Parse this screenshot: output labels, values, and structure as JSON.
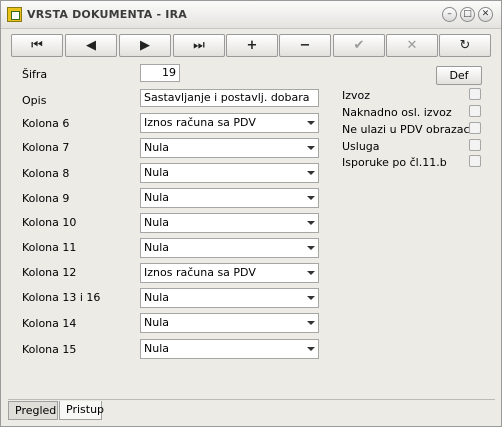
{
  "window": {
    "title": "VRSTA DOKUMENTA - IRA"
  },
  "toolbar": {
    "buttons": [
      {
        "icon": "first-record-icon",
        "glyph": "⏮"
      },
      {
        "icon": "prev-record-icon",
        "glyph": "◀"
      },
      {
        "icon": "next-record-icon",
        "glyph": "▶"
      },
      {
        "icon": "last-record-icon",
        "glyph": "⏭"
      },
      {
        "icon": "add-icon",
        "glyph": "+"
      },
      {
        "icon": "delete-icon",
        "glyph": "−"
      },
      {
        "icon": "confirm-icon",
        "glyph": "✔"
      },
      {
        "icon": "cancel-icon",
        "glyph": "✕"
      },
      {
        "icon": "refresh-icon",
        "glyph": "↻"
      }
    ]
  },
  "form": {
    "sifra_label": "Šifra",
    "sifra_value": "19",
    "opis_label": "Opis",
    "opis_value": "Sastavljanje i postavlj. dobara",
    "def_button": "Def",
    "columns": [
      {
        "label": "Kolona 6",
        "value": "Iznos računa sa PDV"
      },
      {
        "label": "Kolona 7",
        "value": "Nula"
      },
      {
        "label": "Kolona 8",
        "value": "Nula"
      },
      {
        "label": "Kolona 9",
        "value": "Nula"
      },
      {
        "label": "Kolona 10",
        "value": "Nula"
      },
      {
        "label": "Kolona 11",
        "value": "Nula"
      },
      {
        "label": "Kolona 12",
        "value": "Iznos računa sa PDV"
      },
      {
        "label": "Kolona 13 i 16",
        "value": "Nula"
      },
      {
        "label": "Kolona 14",
        "value": "Nula"
      },
      {
        "label": "Kolona 15",
        "value": "Nula"
      }
    ],
    "checkboxes": [
      {
        "label": "Izvoz",
        "checked": false
      },
      {
        "label": "Naknadno osl. izvoz",
        "checked": false
      },
      {
        "label": "Ne ulazi u PDV obrazac",
        "checked": false
      },
      {
        "label": "Usluga",
        "checked": false
      },
      {
        "label": "Isporuke po čl.11.b",
        "checked": false
      }
    ]
  },
  "tabs": {
    "pregled": "Pregled",
    "pristup": "Pristup"
  }
}
